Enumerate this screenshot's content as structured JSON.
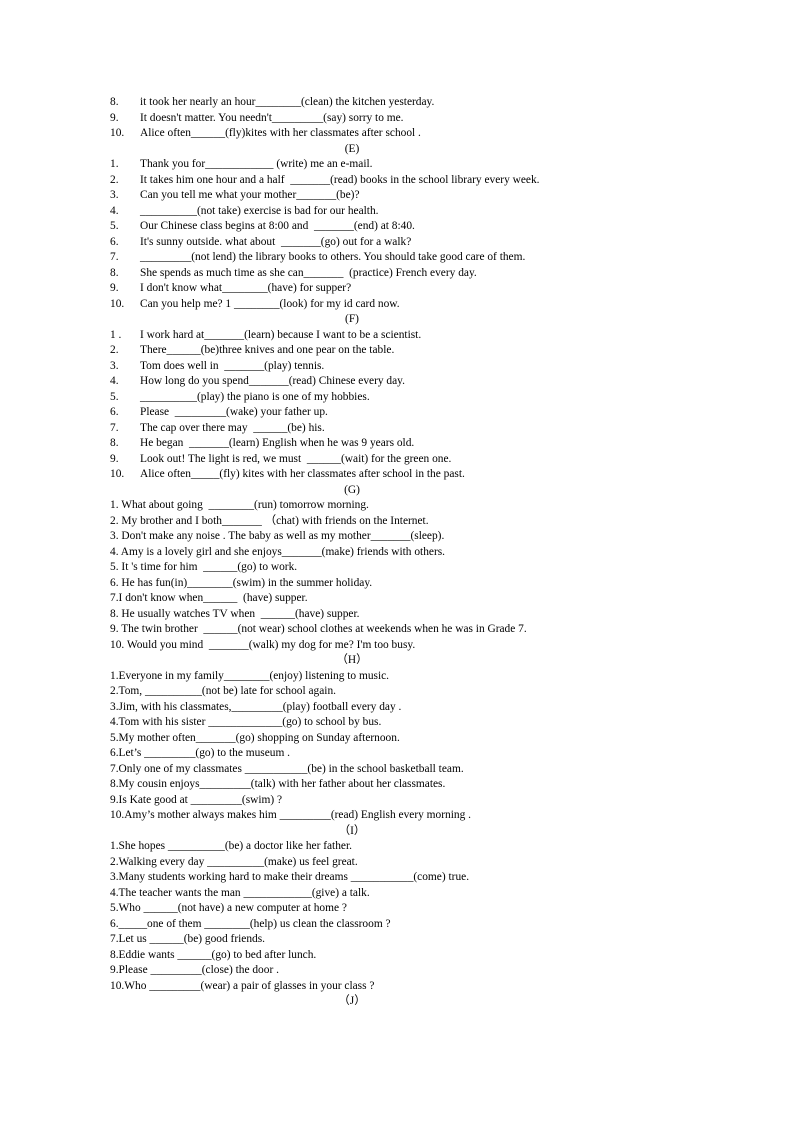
{
  "document": {
    "type": "grammar-fill-in-the-blank-worksheet",
    "font_color": "#000000",
    "background_color": "#ffffff"
  },
  "sections": [
    {
      "id": "D-tail",
      "header": null,
      "style": "tabbed",
      "items": [
        {
          "num": "8.",
          "text": "it took her nearly an hour________(clean) the kitchen yesterday."
        },
        {
          "num": "9.",
          "text": "It doesn't matter. You needn't_________(say) sorry to me."
        },
        {
          "num": "10.",
          "text": "Alice often______(fly)kites with her classmates after school ."
        }
      ]
    },
    {
      "id": "E",
      "header": "(E)",
      "style": "tabbed",
      "items": [
        {
          "num": "1.",
          "text": "Thank you for____________ (write) me an e-mail."
        },
        {
          "num": "2.",
          "text": "It takes him one hour and a half  _______(read) books in the school library every week."
        },
        {
          "num": "3.",
          "text": "Can you tell me what your mother_______(be)?"
        },
        {
          "num": "4.",
          "text": "__________(not take) exercise is bad for our health."
        },
        {
          "num": "5.",
          "text": "Our Chinese class begins at 8:00 and  _______(end) at 8:40."
        },
        {
          "num": "6.",
          "text": "It's sunny outside. what about  _______(go) out for a walk?"
        },
        {
          "num": "7.",
          "text": "_________(not lend) the library books to others. You should take good care of them."
        },
        {
          "num": "8.",
          "text": "She spends as much time as she can_______  (practice) French every day."
        },
        {
          "num": "9.",
          "text": "I don't know what________(have) for supper?"
        },
        {
          "num": "10.",
          "text": "Can you help me? 1 ________(look) for my id card now."
        }
      ]
    },
    {
      "id": "F",
      "header": "(F)",
      "style": "tabbed",
      "items": [
        {
          "num": "1 .",
          "text": "I work hard at_______(learn) because I want to be a scientist."
        },
        {
          "num": "2.",
          "text": "There______(be)three knives and one pear on the table."
        },
        {
          "num": "3.",
          "text": "Tom does well in  _______(play) tennis."
        },
        {
          "num": "4.",
          "text": "How long do you spend_______(read) Chinese every day."
        },
        {
          "num": "5.",
          "text": "__________(play) the piano is one of my hobbies."
        },
        {
          "num": "6.",
          "text": "Please  _________(wake) your father up."
        },
        {
          "num": "7.",
          "text": "The cap over there may  ______(be) his."
        },
        {
          "num": "8.",
          "text": "He began  _______(learn) English when he was 9 years old."
        },
        {
          "num": "9.",
          "text": "Look out! The light is red, we must  ______(wait) for the green one."
        },
        {
          "num": "10.",
          "text": "Alice often_____(fly) kites with her classmates after school in the past."
        }
      ]
    },
    {
      "id": "G",
      "header": "(G)",
      "style": "plain",
      "items": [
        {
          "num": "1.",
          "text": " What about going  ________(run) tomorrow morning."
        },
        {
          "num": "2.",
          "text": " My brother and I both_______ （chat) with friends on the Internet."
        },
        {
          "num": "3.",
          "text": " Don't make any noise . The baby as well as my mother_______(sleep)."
        },
        {
          "num": "4.",
          "text": " Amy is a lovely girl and she enjoys_______(make) friends with others."
        },
        {
          "num": "5.",
          "text": " It 's time for him  ______(go) to work."
        },
        {
          "num": "6.",
          "text": " He has fun(in)________(swim) in the summer holiday."
        },
        {
          "num": "7.",
          "text": "I don't know when______  (have) supper."
        },
        {
          "num": "8.",
          "text": " He usually watches TV when  ______(have) supper."
        },
        {
          "num": "9.",
          "text": " The twin brother  ______(not wear) school clothes at weekends when he was in Grade 7."
        },
        {
          "num": "10.",
          "text": " Would you mind  _______(walk) my dog for me? I'm too busy."
        }
      ]
    },
    {
      "id": "H",
      "header": "（H）",
      "style": "plain",
      "items": [
        {
          "num": "1.",
          "text": "Everyone in my family________(enjoy) listening to music."
        },
        {
          "num": "2.",
          "text": "Tom, __________(not be) late for school again."
        },
        {
          "num": "3.",
          "text": "Jim, with his classmates,_________(play) football every day ."
        },
        {
          "num": "4.",
          "text": "Tom with his sister _____________(go) to school by bus."
        },
        {
          "num": "5.",
          "text": "My mother often_______(go) shopping on Sunday afternoon."
        },
        {
          "num": "6.",
          "text": "Let’s _________(go) to the museum ."
        },
        {
          "num": "7.",
          "text": "Only one of my classmates ___________(be) in the school basketball team."
        },
        {
          "num": "8.",
          "text": "My cousin enjoys_________(talk) with her father about her classmates."
        },
        {
          "num": "9.",
          "text": "Is Kate good at _________(swim) ?"
        },
        {
          "num": "10.",
          "text": "Amy’s mother always makes him _________(read) English every morning ."
        }
      ]
    },
    {
      "id": "I",
      "header": "（I）",
      "style": "plain",
      "items": [
        {
          "num": "1.",
          "text": "She hopes __________(be) a doctor like her father."
        },
        {
          "num": "2.",
          "text": "Walking every day __________(make) us feel great."
        },
        {
          "num": "3.",
          "text": "Many students working hard to make their dreams ___________(come) true."
        },
        {
          "num": "4.",
          "text": "The teacher wants the man ____________(give) a talk."
        },
        {
          "num": "5.",
          "text": "Who ______(not have) a new computer at home ?"
        },
        {
          "num": "6.",
          "text": "_____one of them ________(help) us clean the classroom ?"
        },
        {
          "num": "7.",
          "text": "Let us ______(be) good friends."
        },
        {
          "num": "8.",
          "text": "Eddie wants ______(go) to bed after lunch."
        },
        {
          "num": "9.",
          "text": "Please _________(close) the door ."
        },
        {
          "num": "10.",
          "text": "Who _________(wear) a pair of glasses in your class ?"
        }
      ]
    },
    {
      "id": "J",
      "header": "（J）",
      "style": "plain",
      "items": []
    }
  ]
}
